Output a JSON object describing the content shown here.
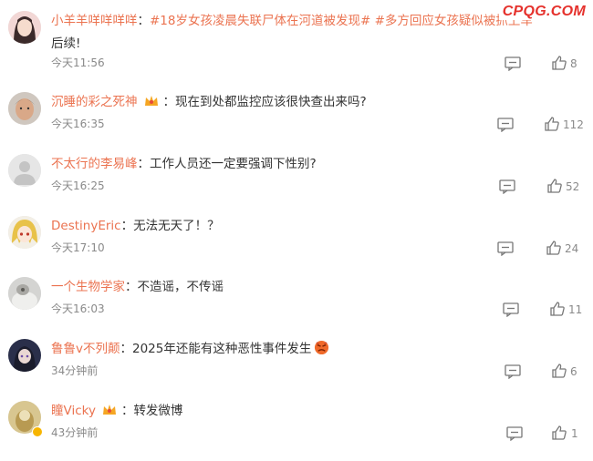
{
  "watermark": "CPQG.COM",
  "comments": [
    {
      "user": "小羊羊咩咩咩咩",
      "sep": "：",
      "text": "#18岁女孩凌晨失联尸体在河道被发现# #多方回应女孩疑似被抓上车",
      "text2": "后续!",
      "time": "今天11:56",
      "likes": "8",
      "avatar_icon": "avatar-girl-icon"
    },
    {
      "user": "沉睡的彩之死神",
      "sep": "：",
      "text": "现在到处都监控应该很快查出来吗?",
      "time": "今天16:35",
      "likes": "112",
      "avatar_icon": "avatar-man-icon"
    },
    {
      "user": "不太行的李易峰",
      "sep": "：",
      "text": "工作人员还一定要强调下性别?",
      "time": "今天16:25",
      "likes": "52",
      "avatar_icon": "avatar-default-icon"
    },
    {
      "user": "DestinyEric",
      "sep": "：",
      "text": "无法无天了！？",
      "time": "今天17:10",
      "likes": "24",
      "avatar_icon": "avatar-anime-icon"
    },
    {
      "user": "一个生物学家",
      "sep": "：",
      "text": "不造谣，不传谣",
      "time": "今天16:03",
      "likes": "11",
      "avatar_icon": "avatar-photo-icon"
    },
    {
      "user": "鲁鲁v不列颠",
      "sep": "：",
      "text": "2025年还能有这种恶性事件发生",
      "time": "34分钟前",
      "likes": "6",
      "avatar_icon": "avatar-dark-icon"
    },
    {
      "user": "瞳Vicky",
      "sep": "：",
      "text": "转发微博",
      "time": "43分钟前",
      "likes": "1",
      "avatar_icon": "avatar-yellow-icon"
    }
  ],
  "colors": {
    "username": "#eb7350",
    "text": "#333333",
    "meta": "#8a8a8a",
    "watermark": "#e5312c"
  }
}
